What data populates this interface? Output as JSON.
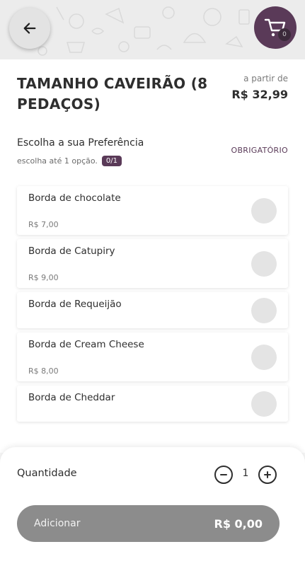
{
  "header": {
    "back_icon": "arrow-left-icon",
    "cart_icon": "shopping-cart-icon",
    "cart_count": "0",
    "accent_color": "#5a3a58"
  },
  "product": {
    "title": "TAMANHO CAVEIRÃO (8 PEDAÇOS)",
    "from_label": "a partir de",
    "from_price": "R$ 32,99"
  },
  "preference": {
    "title": "Escolha a sua Preferência",
    "subtitle": "escolha até 1 opção.",
    "count": "0/1",
    "required_label": "OBRIGATÓRIO"
  },
  "options": [
    {
      "name": "Borda de chocolate",
      "price": "R$ 7,00"
    },
    {
      "name": "Borda de Catupiry",
      "price": "R$ 9,00"
    },
    {
      "name": "Borda de Requeijão",
      "price": ""
    },
    {
      "name": "Borda de Cream Cheese",
      "price": "R$ 8,00"
    },
    {
      "name": "Borda de Cheddar",
      "price": ""
    }
  ],
  "footer": {
    "quantity_label": "Quantidade",
    "quantity_value": "1",
    "add_label": "Adicionar",
    "add_total": "R$ 0,00"
  }
}
